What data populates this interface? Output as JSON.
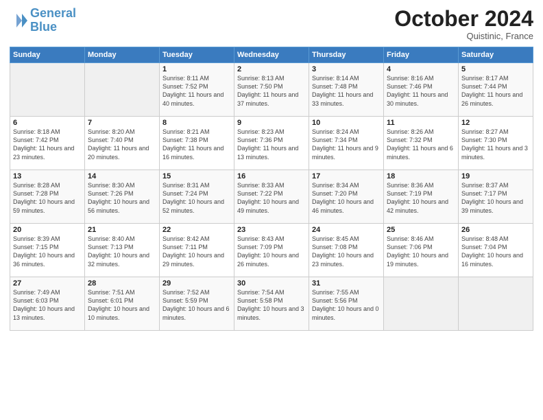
{
  "header": {
    "logo_line1": "General",
    "logo_line2": "Blue",
    "month": "October 2024",
    "location": "Quistinic, France"
  },
  "weekdays": [
    "Sunday",
    "Monday",
    "Tuesday",
    "Wednesday",
    "Thursday",
    "Friday",
    "Saturday"
  ],
  "weeks": [
    [
      {
        "day": "",
        "info": ""
      },
      {
        "day": "",
        "info": ""
      },
      {
        "day": "1",
        "info": "Sunrise: 8:11 AM\nSunset: 7:52 PM\nDaylight: 11 hours and 40 minutes."
      },
      {
        "day": "2",
        "info": "Sunrise: 8:13 AM\nSunset: 7:50 PM\nDaylight: 11 hours and 37 minutes."
      },
      {
        "day": "3",
        "info": "Sunrise: 8:14 AM\nSunset: 7:48 PM\nDaylight: 11 hours and 33 minutes."
      },
      {
        "day": "4",
        "info": "Sunrise: 8:16 AM\nSunset: 7:46 PM\nDaylight: 11 hours and 30 minutes."
      },
      {
        "day": "5",
        "info": "Sunrise: 8:17 AM\nSunset: 7:44 PM\nDaylight: 11 hours and 26 minutes."
      }
    ],
    [
      {
        "day": "6",
        "info": "Sunrise: 8:18 AM\nSunset: 7:42 PM\nDaylight: 11 hours and 23 minutes."
      },
      {
        "day": "7",
        "info": "Sunrise: 8:20 AM\nSunset: 7:40 PM\nDaylight: 11 hours and 20 minutes."
      },
      {
        "day": "8",
        "info": "Sunrise: 8:21 AM\nSunset: 7:38 PM\nDaylight: 11 hours and 16 minutes."
      },
      {
        "day": "9",
        "info": "Sunrise: 8:23 AM\nSunset: 7:36 PM\nDaylight: 11 hours and 13 minutes."
      },
      {
        "day": "10",
        "info": "Sunrise: 8:24 AM\nSunset: 7:34 PM\nDaylight: 11 hours and 9 minutes."
      },
      {
        "day": "11",
        "info": "Sunrise: 8:26 AM\nSunset: 7:32 PM\nDaylight: 11 hours and 6 minutes."
      },
      {
        "day": "12",
        "info": "Sunrise: 8:27 AM\nSunset: 7:30 PM\nDaylight: 11 hours and 3 minutes."
      }
    ],
    [
      {
        "day": "13",
        "info": "Sunrise: 8:28 AM\nSunset: 7:28 PM\nDaylight: 10 hours and 59 minutes."
      },
      {
        "day": "14",
        "info": "Sunrise: 8:30 AM\nSunset: 7:26 PM\nDaylight: 10 hours and 56 minutes."
      },
      {
        "day": "15",
        "info": "Sunrise: 8:31 AM\nSunset: 7:24 PM\nDaylight: 10 hours and 52 minutes."
      },
      {
        "day": "16",
        "info": "Sunrise: 8:33 AM\nSunset: 7:22 PM\nDaylight: 10 hours and 49 minutes."
      },
      {
        "day": "17",
        "info": "Sunrise: 8:34 AM\nSunset: 7:20 PM\nDaylight: 10 hours and 46 minutes."
      },
      {
        "day": "18",
        "info": "Sunrise: 8:36 AM\nSunset: 7:19 PM\nDaylight: 10 hours and 42 minutes."
      },
      {
        "day": "19",
        "info": "Sunrise: 8:37 AM\nSunset: 7:17 PM\nDaylight: 10 hours and 39 minutes."
      }
    ],
    [
      {
        "day": "20",
        "info": "Sunrise: 8:39 AM\nSunset: 7:15 PM\nDaylight: 10 hours and 36 minutes."
      },
      {
        "day": "21",
        "info": "Sunrise: 8:40 AM\nSunset: 7:13 PM\nDaylight: 10 hours and 32 minutes."
      },
      {
        "day": "22",
        "info": "Sunrise: 8:42 AM\nSunset: 7:11 PM\nDaylight: 10 hours and 29 minutes."
      },
      {
        "day": "23",
        "info": "Sunrise: 8:43 AM\nSunset: 7:09 PM\nDaylight: 10 hours and 26 minutes."
      },
      {
        "day": "24",
        "info": "Sunrise: 8:45 AM\nSunset: 7:08 PM\nDaylight: 10 hours and 23 minutes."
      },
      {
        "day": "25",
        "info": "Sunrise: 8:46 AM\nSunset: 7:06 PM\nDaylight: 10 hours and 19 minutes."
      },
      {
        "day": "26",
        "info": "Sunrise: 8:48 AM\nSunset: 7:04 PM\nDaylight: 10 hours and 16 minutes."
      }
    ],
    [
      {
        "day": "27",
        "info": "Sunrise: 7:49 AM\nSunset: 6:03 PM\nDaylight: 10 hours and 13 minutes."
      },
      {
        "day": "28",
        "info": "Sunrise: 7:51 AM\nSunset: 6:01 PM\nDaylight: 10 hours and 10 minutes."
      },
      {
        "day": "29",
        "info": "Sunrise: 7:52 AM\nSunset: 5:59 PM\nDaylight: 10 hours and 6 minutes."
      },
      {
        "day": "30",
        "info": "Sunrise: 7:54 AM\nSunset: 5:58 PM\nDaylight: 10 hours and 3 minutes."
      },
      {
        "day": "31",
        "info": "Sunrise: 7:55 AM\nSunset: 5:56 PM\nDaylight: 10 hours and 0 minutes."
      },
      {
        "day": "",
        "info": ""
      },
      {
        "day": "",
        "info": ""
      }
    ]
  ]
}
